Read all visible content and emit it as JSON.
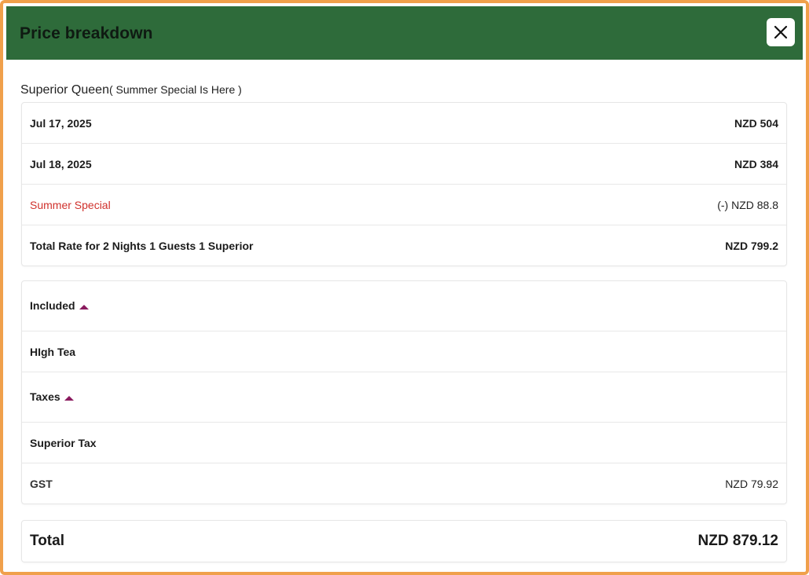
{
  "modal": {
    "title": "Price breakdown",
    "close_icon": "close-icon"
  },
  "room": {
    "name": "Superior Queen",
    "subtitle": "( Summer Special Is Here )"
  },
  "rates": [
    {
      "label": "Jul 17, 2025",
      "amount": "NZD 504"
    },
    {
      "label": "Jul 18, 2025",
      "amount": "NZD 384"
    }
  ],
  "discount": {
    "label": "Summer Special",
    "amount": "(-) NZD 88.8",
    "color": "#d0322d"
  },
  "subtotal": {
    "label": "Total Rate for 2 Nights 1 Guests 1 Superior",
    "amount": "NZD 799.2"
  },
  "included": {
    "label": "Included",
    "items": [
      "HIgh Tea"
    ]
  },
  "taxes": {
    "label": "Taxes",
    "group": "Superior Tax",
    "items": [
      {
        "label": "GST",
        "amount": "NZD 79.92"
      }
    ]
  },
  "total": {
    "label": "Total",
    "amount": "NZD 879.12"
  },
  "colors": {
    "header": "#2e6b3a",
    "border": "#f0a04b",
    "caret": "#8a1a5e"
  }
}
